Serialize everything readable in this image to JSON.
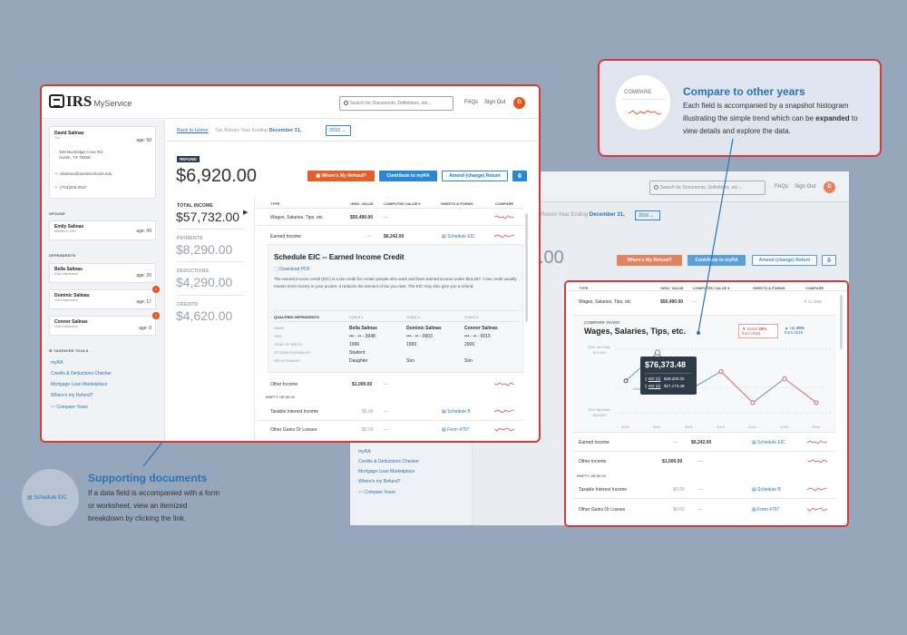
{
  "app": {
    "logo": "IRS",
    "service": "MyService",
    "search_placeholder": "Search for Documents, Definitions, etc...",
    "faqs": "FAQs",
    "sign_out": "Sign Out",
    "avatar": "D"
  },
  "profile": {
    "name": "David Salinas",
    "role": "You",
    "age": "age: 50",
    "address1": "929 Buckridge Cove Rd.",
    "address2": "Austin, TX 78268",
    "email": "dsalinas@austinschools.edu",
    "phone": "(703)205-0547"
  },
  "spouse": {
    "heading": "SPOUSE",
    "name": "Emily Salinas",
    "sub": "Married in 1991",
    "age": "age: 49"
  },
  "dependents": {
    "heading": "DEPENDENTS",
    "items": [
      {
        "name": "Bella Salinas",
        "sub": "Child Dependent",
        "age": "age: 20"
      },
      {
        "name": "Dominic Salinas",
        "sub": "Child Dependent",
        "age": "age: 17",
        "badge": "1"
      },
      {
        "name": "Connor Salinas",
        "sub": "Child Dependent",
        "age": "age: 9",
        "badge": "2"
      }
    ]
  },
  "tools": {
    "heading": "TAXPAYER TOOLS",
    "items": [
      "myRA",
      "Credits & Deductions Checker",
      "Mortgage Loan Marketplace",
      "Where's my Refund?",
      "Compare Years"
    ]
  },
  "header": {
    "back": "Back to Home",
    "ending_label": "Tax Return Year Ending",
    "ending_date": "December 31,",
    "year": "2016"
  },
  "refund": {
    "label": "REFUND",
    "amount": "$6,920.00"
  },
  "actions": {
    "refund_btn": "Where's My Refund?",
    "contribute_btn": "Contribute to myRA",
    "amend_btn": "Amend (change) Return"
  },
  "totals": [
    {
      "label": "TOTAL INCOME",
      "value": "$57,732.00"
    },
    {
      "label": "PAYMENTS",
      "value": "$8,290.00"
    },
    {
      "label": "DEDUCTIONS",
      "value": "$4,290.00"
    },
    {
      "label": "CREDITS",
      "value": "$4,620.00"
    }
  ],
  "table": {
    "headers": [
      "TYPE",
      "ORIG. VALUE",
      "COMPUTED VALUE",
      "SHEETS & FORMS",
      "COMPARE"
    ],
    "rows": [
      {
        "type": "Wages, Salaries, Tips, etc.",
        "orig": "$50,490.00",
        "comp": "—",
        "sheet": ""
      },
      {
        "type": "Earned Income",
        "orig": "—",
        "comp": "$6,242.00",
        "sheet": "Schedule EIC"
      }
    ],
    "rows2": [
      {
        "type": "Other Income",
        "orig": "$1,000.00",
        "comp": "—",
        "sheet": ""
      },
      {
        "type": "Taxable Interest Income",
        "orig": "$0.00",
        "comp": "—",
        "sheet": "Schedule B"
      },
      {
        "type": "Other Gains Or Losses",
        "orig": "$0.00",
        "comp": "—",
        "sheet": "Form 4797"
      }
    ],
    "empty_label": "EMPTY OR $0.00"
  },
  "eic": {
    "title": "Schedule EIC -- Earned Income Credit",
    "download": "Download PDF",
    "desc": "The earned income credit (EIC) is a tax credit for certain people who work and have earned income under $53,267. A tax credit usually means more money in your pocket. It reduces the amount of tax you owe. The EIC may also give you a refund.",
    "cols": [
      "QUALIFIED DEPENDENTS",
      "CHILD 1",
      "CHILD 2",
      "CHILD 3"
    ],
    "rows": [
      [
        "NAME",
        "Bella Salinas",
        "Dominic Salinas",
        "Connor Salinas"
      ],
      [
        "SSN",
        "••• - •• - 3948",
        "••• - •• - 0903",
        "••• - •• - 0015"
      ],
      [
        "YEAR OF BIRTH",
        "1996",
        "1999",
        "2006"
      ],
      [
        "STUDENT/DISABLED",
        "Student",
        "",
        ""
      ],
      [
        "RELATIONSHIP",
        "Daughter",
        "Son",
        "Son"
      ]
    ]
  },
  "compare_callout": {
    "label": "COMPARE",
    "title": "Compare to other years",
    "text_a": "Each field is accompanied by a snapshot histogram illustrating the simple trend which can be ",
    "text_bold": "expanded",
    "text_b": " to view details and explore the data."
  },
  "support_callout": {
    "icon_label": "Schedule EIC",
    "title": "Supporting documents",
    "text": "If a data field is accompanied with a form or worksheet, view an itemized breakdown by clicking the link."
  },
  "compare_panel": {
    "headers": [
      "TYPE",
      "ORIG. VALUE",
      "COMPUTED VALUE",
      "SHEETS & FORMS",
      "COMPARE"
    ],
    "row_type": "Wages, Salaries, Tips, etc",
    "row_orig": "$50,490.00",
    "close": "CLOSE",
    "chart_label": "COMPARE YEARS",
    "chart_title": "Wages, Salaries, Tips, etc.",
    "down_label": "Down",
    "down_pct": "28%",
    "down_from": "from 2015",
    "up_label": "Up",
    "up_pct": "35%",
    "up_from": "from 2010",
    "tooltip_value": "$76,373.48",
    "tooltip_w2_1": "W2 (1)",
    "tooltip_v1": "$49,200.00",
    "tooltip_w2_2": "W2 (2)",
    "tooltip_v2": "$27,173.48",
    "bracket_top": "25% Tax Rate",
    "bracket_top_v": "$74,901",
    "inflation": "Inflation from 2010",
    "bracket_bot": "15% Tax Rate",
    "bracket_bot_v": "$18,451",
    "rows": [
      {
        "type": "Earned Income",
        "orig": "—",
        "comp": "$6,242.00",
        "sheet": "Schedule EIC"
      },
      {
        "type": "Other Income",
        "orig": "$1,000.00",
        "comp": "—",
        "sheet": ""
      },
      {
        "type": "Taxable Interest Income",
        "orig": "$0.00",
        "comp": "—",
        "sheet": "Schedule B"
      },
      {
        "type": "Other Gains Or Losses",
        "orig": "$0.00",
        "comp": "—",
        "sheet": "Form 4797"
      }
    ],
    "empty_label": "EMPTY OR $0.00"
  },
  "chart_data": {
    "type": "line",
    "title": "Wages, Salaries, Tips, etc.",
    "x": [
      "2010",
      "2011",
      "2012",
      "2013",
      "2014",
      "2015",
      "2016"
    ],
    "series": [
      {
        "name": "",
        "values": [
          56400,
          76373,
          50000,
          63000,
          41000,
          58000,
          41000
        ]
      }
    ],
    "colors": {
      "rise": "#4a86c5",
      "fall": "#d9534f"
    }
  },
  "bg_window": {
    "search_placeholder": "Search for Documents, Definitions, etc...",
    "faqs": "FAQs",
    "sign_out": "Sign Out",
    "ending": "Return Year Ending",
    "ending_date": "December 31,",
    "year": "2016",
    "amount": ".00",
    "refund_btn": "Where's My Refund?",
    "contribute_btn": "Contribute to myRA",
    "amend_btn": "Amend (change) Return",
    "tools": [
      "myRA",
      "Credits & Deductions Checker",
      "Mortgage Loan Marketplace",
      "Where's my Refund?",
      "Compare Years"
    ]
  }
}
